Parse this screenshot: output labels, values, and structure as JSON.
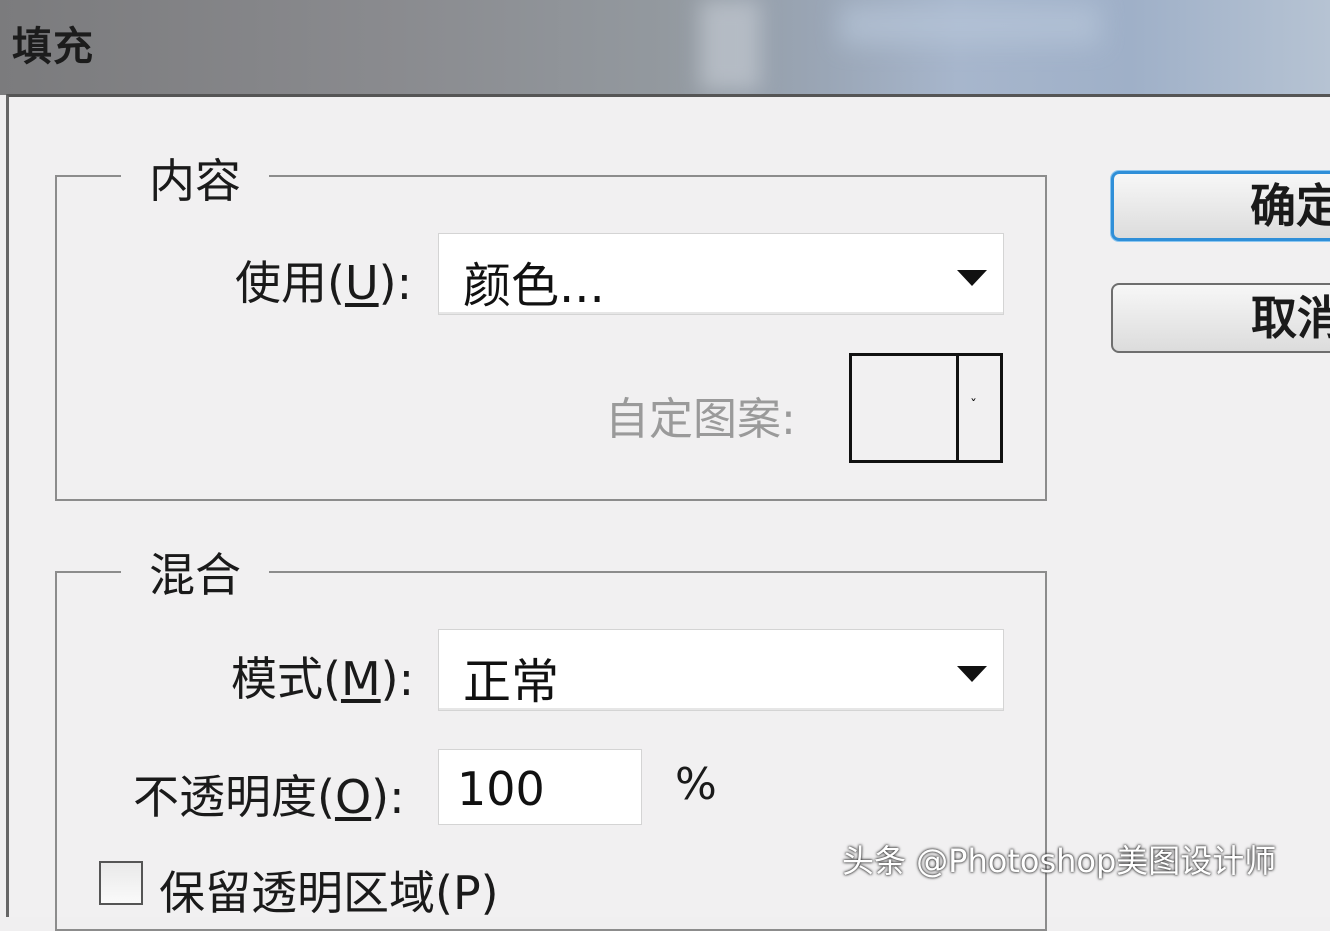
{
  "window": {
    "title": "填充"
  },
  "content_group": {
    "legend": "内容",
    "use_label": "使用(",
    "use_hotkey": "U",
    "use_label_end": "):",
    "use_value": "颜色...",
    "custom_pattern_label": "自定图案:"
  },
  "blend_group": {
    "legend": "混合",
    "mode_label": "模式(",
    "mode_hotkey": "M",
    "mode_label_end": "):",
    "mode_value": "正常",
    "opacity_label": "不透明度(",
    "opacity_hotkey": "O",
    "opacity_label_end": "):",
    "opacity_value": "100",
    "opacity_unit": "%",
    "preserve_label": "保留透明区域(P)",
    "preserve_checked": false
  },
  "buttons": {
    "ok": "确定",
    "cancel": "取消"
  },
  "watermark": "头条 @Photoshop美图设计师"
}
